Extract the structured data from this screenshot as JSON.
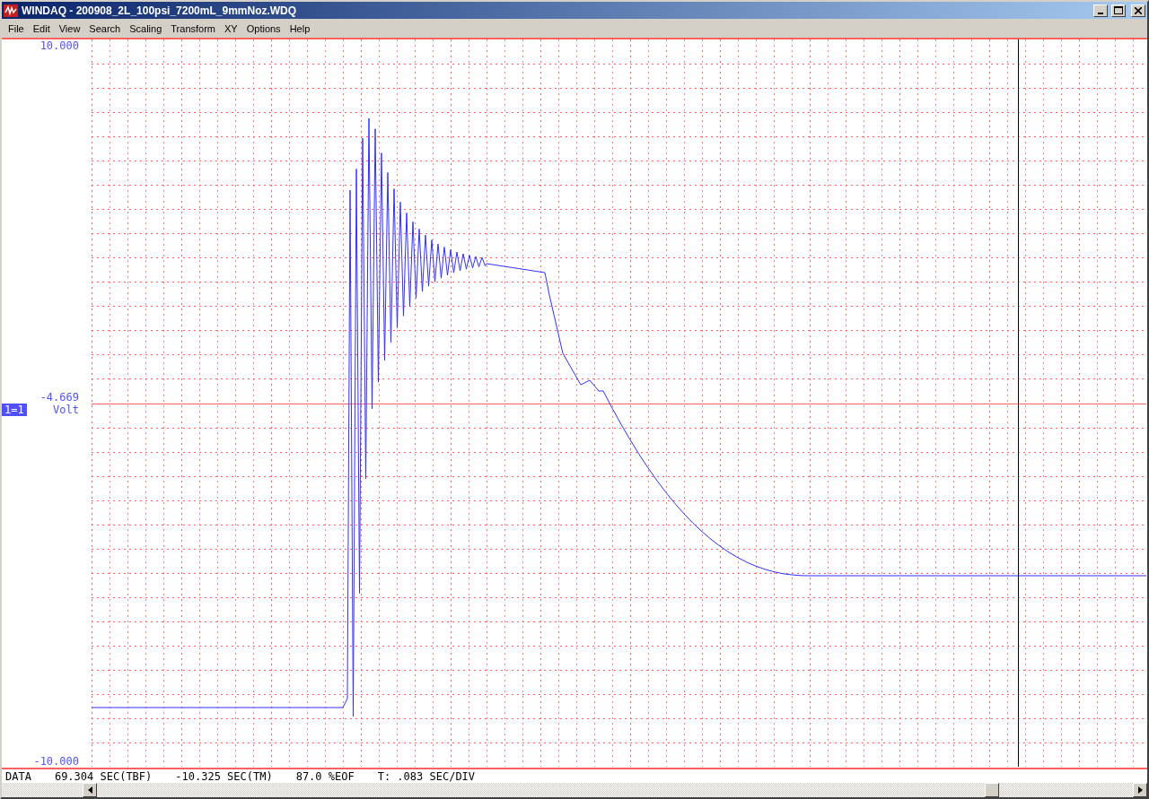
{
  "window": {
    "title": "WINDAQ - 200908_2L_100psi_7200mL_9mmNoz.WDQ"
  },
  "menu": [
    "File",
    "Edit",
    "View",
    "Search",
    "Scaling",
    "Transform",
    "XY",
    "Options",
    "Help"
  ],
  "plot": {
    "top_label": "10.000",
    "mid_label": "-4.669",
    "channel": "1=1",
    "unit": "Volt",
    "bottom_label": "-10.000"
  },
  "status_bar": [
    "DATA",
    "69.304 SEC(TBF)",
    "-10.325 SEC(TM)",
    "87.0 %EOF",
    "T: .083 SEC/DIV"
  ]
}
